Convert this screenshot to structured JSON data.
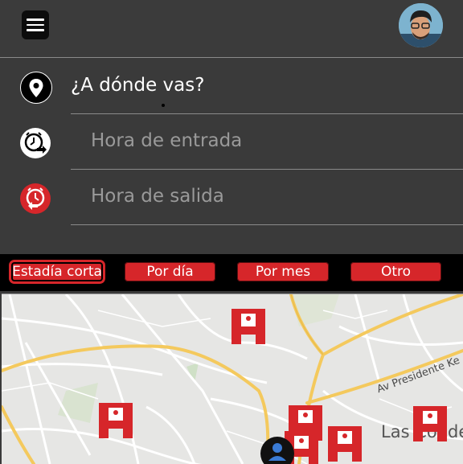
{
  "header": {
    "menu_icon": "hamburger-menu-icon",
    "avatar_icon": "user-avatar"
  },
  "search": {
    "destination_placeholder": "¿A dónde vas?",
    "entry_placeholder": "Hora de entrada",
    "exit_placeholder": "Hora de salida",
    "destination_icon": "location-pin-icon",
    "entry_icon": "clock-entry-icon",
    "exit_icon": "clock-exit-icon"
  },
  "filters": [
    {
      "label": "Estadía corta",
      "selected": true
    },
    {
      "label": "Por día",
      "selected": false
    },
    {
      "label": "Por mes",
      "selected": false
    },
    {
      "label": "Otro",
      "selected": false
    }
  ],
  "map": {
    "street_label": "Av Presidente Ke",
    "place_label": "Las Condes",
    "marker_icon": "parking-marker-icon",
    "location_icon": "user-location-icon"
  },
  "colors": {
    "accent": "#d6262a",
    "background": "#3a3a3a",
    "map_road": "#f4c95d"
  }
}
